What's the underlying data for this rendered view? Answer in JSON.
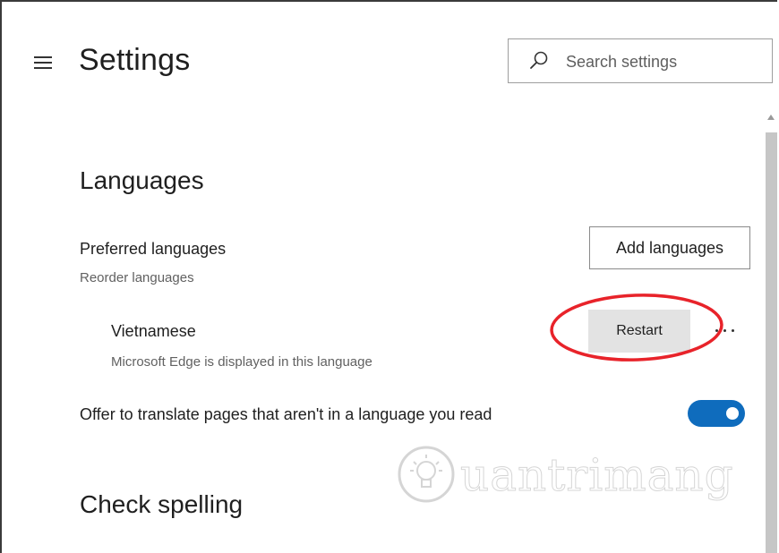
{
  "header": {
    "title": "Settings",
    "menu_icon": "hamburger-menu-icon",
    "search": {
      "placeholder": "Search settings",
      "value": "",
      "icon": "search-icon"
    }
  },
  "languages": {
    "section_title": "Languages",
    "preferred": {
      "title": "Preferred languages",
      "subtitle": "Reorder languages",
      "add_button_label": "Add languages"
    },
    "items": [
      {
        "name": "Vietnamese",
        "description": "Microsoft Edge is displayed in this language",
        "action_label": "Restart",
        "more_icon": "more-options-icon"
      }
    ],
    "translate_offer": {
      "label": "Offer to translate pages that aren't in a language you read",
      "enabled": true
    }
  },
  "check_spelling": {
    "section_title": "Check spelling"
  },
  "watermark": {
    "text": "uantrimang"
  },
  "colors": {
    "toggle_on": "#0f6cbd",
    "annotation": "#e8232a",
    "restart_bg": "#e3e3e3"
  }
}
